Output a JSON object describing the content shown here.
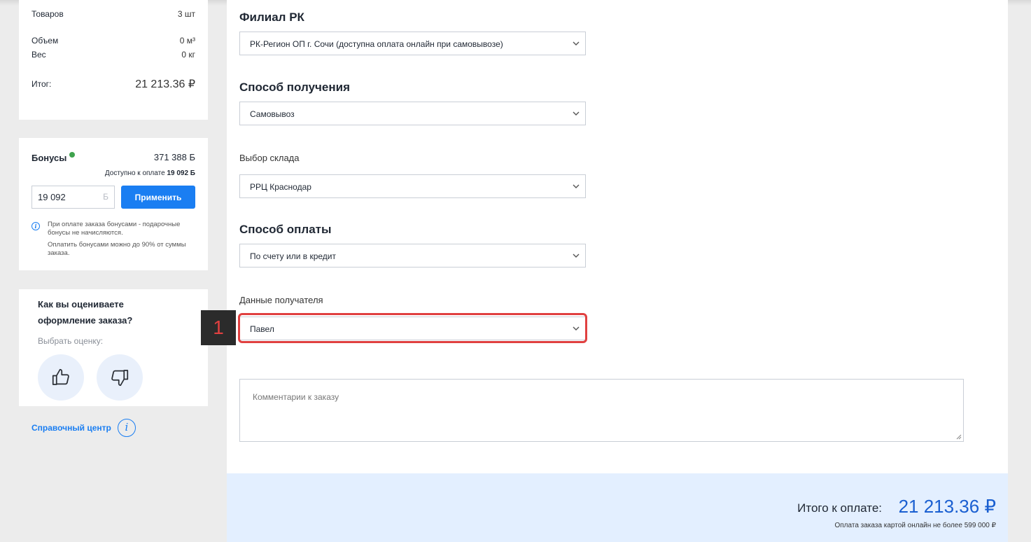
{
  "summary": {
    "items_label": "Товаров",
    "items_value": "3 шт",
    "volume_label": "Объем",
    "volume_value": "0 м³",
    "weight_label": "Вес",
    "weight_value": "0 кг",
    "total_label": "Итог:",
    "total_value": "21 213.36 ₽"
  },
  "bonus": {
    "title": "Бонусы",
    "balance": "371 388 Б",
    "available_prefix": "Доступно к оплате",
    "available_value": "19 092 Б",
    "input_value": "19 092",
    "input_unit": "Б",
    "apply_label": "Применить",
    "note_1": "При оплате заказа бонусами - подарочные бонусы не начисляются.",
    "note_2": "Оплатить бонусами можно до 90% от суммы заказа."
  },
  "rating": {
    "question": "Как вы оцениваете оформление заказа?",
    "subtitle": "Выбрать оценку:",
    "like_icon": "thumbs-up-icon",
    "dislike_icon": "thumbs-down-icon"
  },
  "help": {
    "label": "Справочный центр"
  },
  "form": {
    "branch_heading": "Филиал РК",
    "branch_value": "РК-Регион ОП г. Сочи (доступна оплата онлайн при самовывозе)",
    "delivery_heading": "Способ получения",
    "delivery_value": "Самовывоз",
    "warehouse_label": "Выбор склада",
    "warehouse_value": "РРЦ Краснодар",
    "payment_heading": "Способ оплаты",
    "payment_value": "По счету или в кредит",
    "recipient_label": "Данные получателя",
    "recipient_value": "Павел",
    "comment_placeholder": "Комментарии к заказу"
  },
  "annotation": {
    "marker": "1",
    "color": "#e04040"
  },
  "footer": {
    "total_label": "Итого к оплате:",
    "total_value": "21 213.36 ₽",
    "note": "Оплата заказа картой онлайн не более 599 000 ₽"
  },
  "colors": {
    "accent": "#1a7ef2",
    "footer_bg": "#e3efff",
    "page_bg": "#ececec"
  }
}
